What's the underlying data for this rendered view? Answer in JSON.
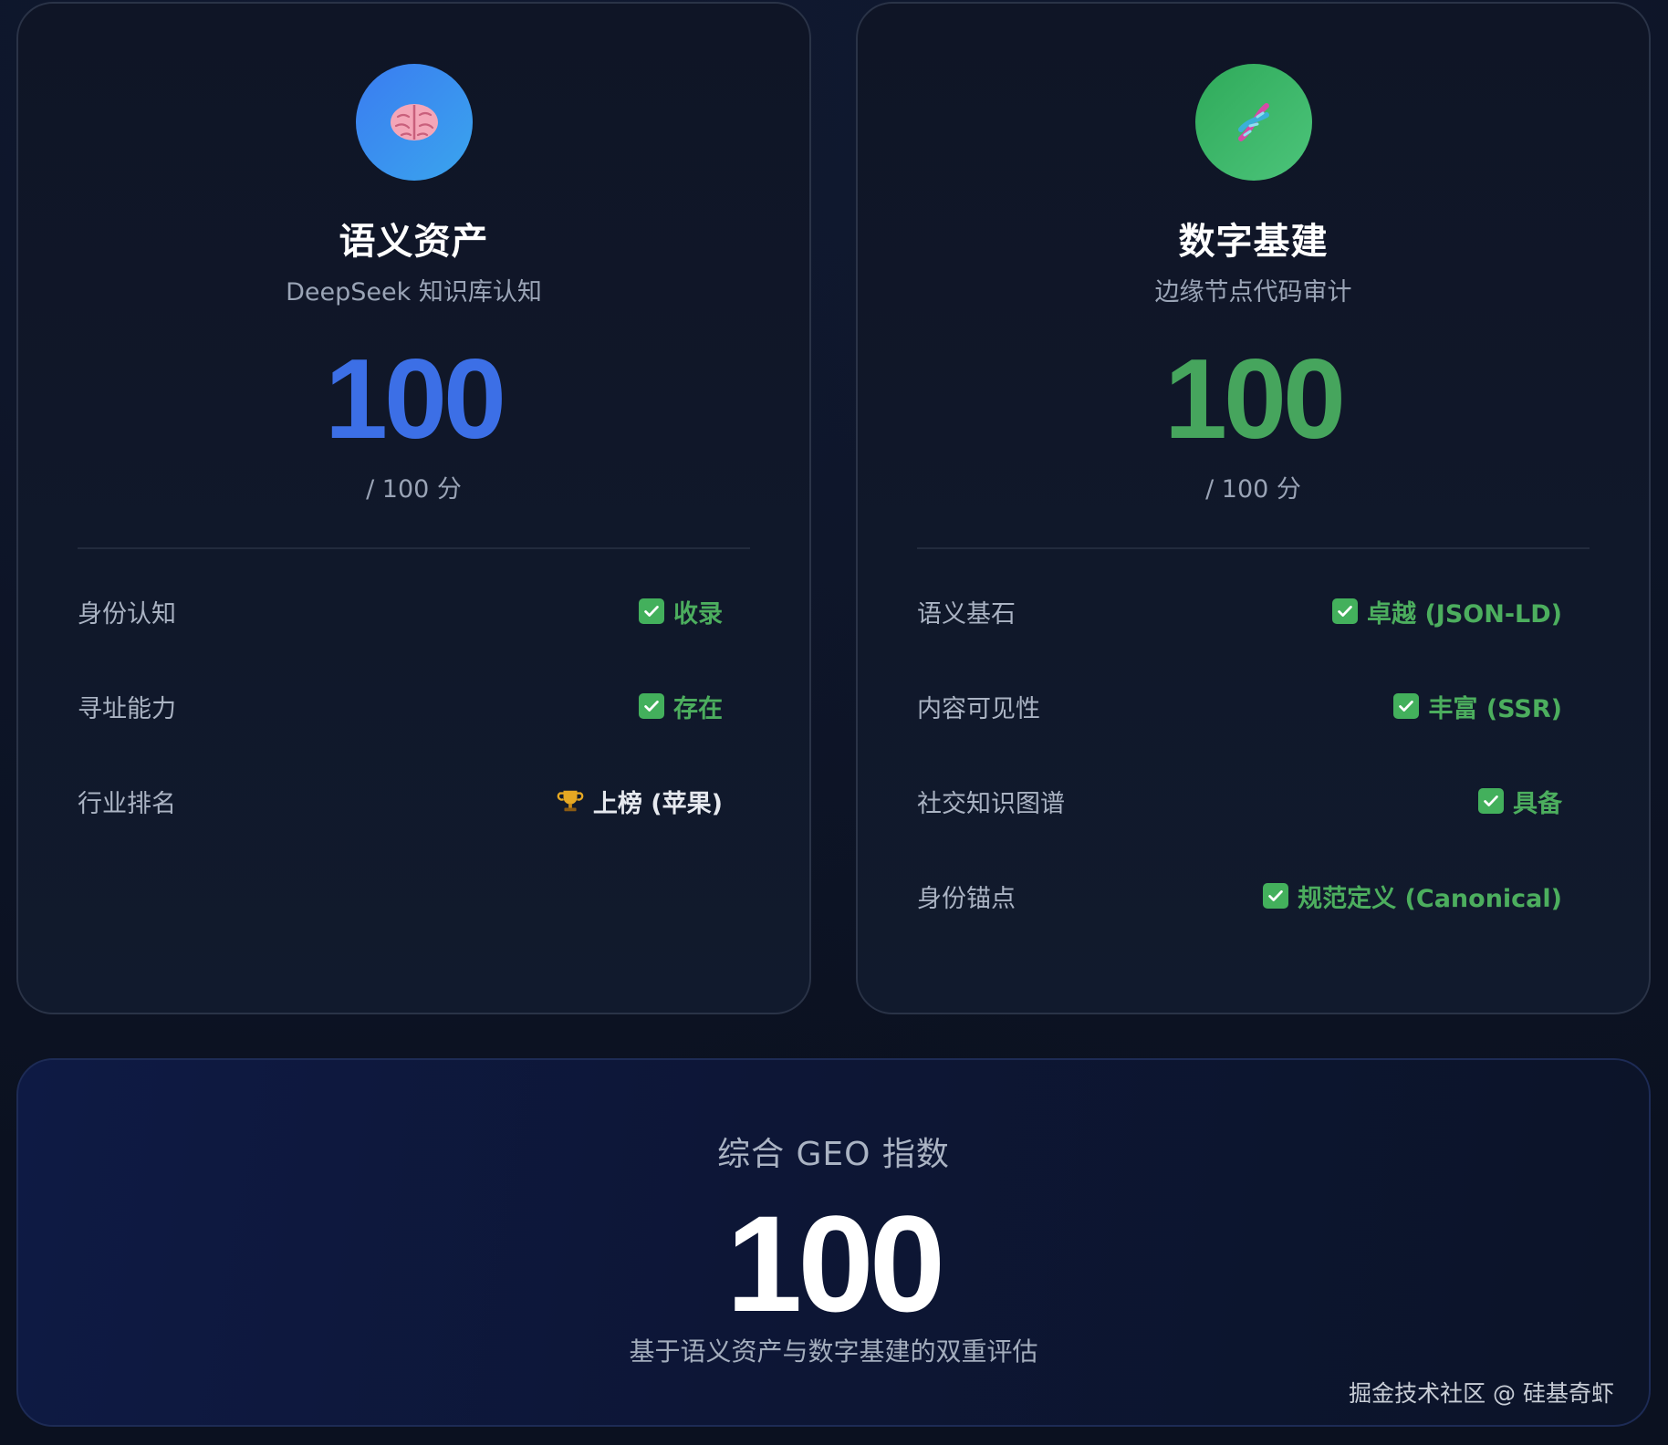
{
  "semantic_card": {
    "icon": "brain-icon",
    "title": "语义资产",
    "subtitle": "DeepSeek 知识库认知",
    "score": "100",
    "max_label": "/ 100 分",
    "accent": "#3c6fe6",
    "rows": [
      {
        "label": "身份认知",
        "value": "收录",
        "icon": "check-icon"
      },
      {
        "label": "寻址能力",
        "value": "存在",
        "icon": "check-icon"
      },
      {
        "label": "行业排名",
        "value": "上榜 (苹果)",
        "icon": "trophy-icon"
      }
    ]
  },
  "infra_card": {
    "icon": "dna-icon",
    "title": "数字基建",
    "subtitle": "边缘节点代码审计",
    "score": "100",
    "max_label": "/ 100 分",
    "accent": "#46a55d",
    "rows": [
      {
        "label": "语义基石",
        "value": "卓越 (JSON-LD)",
        "icon": "check-icon"
      },
      {
        "label": "内容可见性",
        "value": "丰富 (SSR)",
        "icon": "check-icon"
      },
      {
        "label": "社交知识图谱",
        "value": "具备",
        "icon": "check-icon"
      },
      {
        "label": "身份锚点",
        "value": "规范定义 (Canonical)",
        "icon": "check-icon"
      }
    ]
  },
  "summary": {
    "title": "综合 GEO 指数",
    "score": "100",
    "description": "基于语义资产与数字基建的双重评估"
  },
  "watermark": "掘金技术社区 @ 硅基奇虾"
}
